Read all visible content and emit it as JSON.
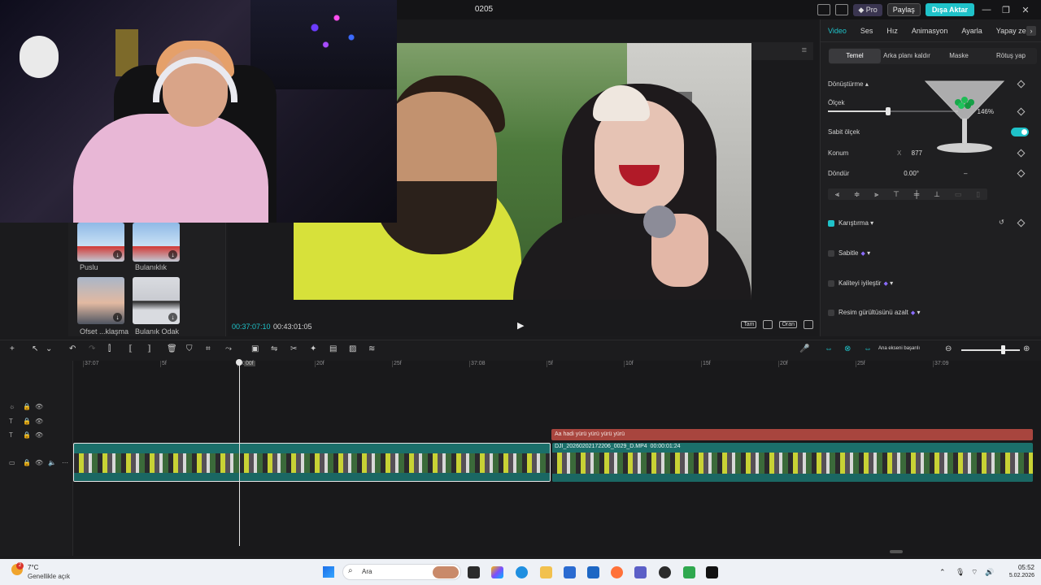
{
  "window": {
    "title": "0205"
  },
  "titlebar": {
    "pro_label": "Pro",
    "share_label": "Paylaş",
    "export_label": "Dışa Aktar",
    "minimize": "—",
    "restore": "❐",
    "close": "✕"
  },
  "media": {
    "items": [
      {
        "label": "Puslu",
        "icon": "download-icon"
      },
      {
        "label": "Bulanıklık",
        "icon": "download-icon"
      },
      {
        "label": "Ofset ...klaşma",
        "icon": "download-icon"
      },
      {
        "label": "Bulanık Odak",
        "icon": "download-icon"
      }
    ]
  },
  "player": {
    "current_time": "00:37:07:10",
    "total_time": "00:43:01:05",
    "menu_icon": "≡",
    "play_icon": "▶",
    "full_label": "Tam",
    "ratio_label": "Oran"
  },
  "inspector": {
    "tabs": [
      "Video",
      "Ses",
      "Hız",
      "Animasyon",
      "Ayarla",
      "Yapay zek"
    ],
    "active_tab": "Video",
    "sub_tabs": [
      "Temel",
      "Arka planı kaldır",
      "Maske",
      "Rötuş yap"
    ],
    "active_sub_tab": "Temel",
    "transform_label": "Dönüştürme",
    "scale_label": "Ölçek",
    "scale_value": "146%",
    "scale_level": 0.46,
    "uniform_scale_label": "Sabit ölçek",
    "uniform_scale_on": true,
    "position_label": "Konum",
    "position_x_label": "X",
    "position_x_value": "877",
    "rotate_label": "Döndür",
    "rotate_value": "0.00°",
    "rotate_dash": "–",
    "blend_label": "Karıştırma",
    "blend_on": true,
    "stabilize_label": "Sabitle",
    "stabilize_on": false,
    "enhance_label": "Kaliteyi iyileştir",
    "enhance_on": false,
    "denoise_label": "Resim gürültüsünü azalt",
    "denoise_on": false
  },
  "timeline": {
    "ruler": [
      "37:07",
      "5f",
      "10f",
      "20f",
      "25f",
      "37:08",
      "5f",
      "10f",
      "15f",
      "20f",
      "25f",
      "37:09"
    ],
    "playhead_label": "00f",
    "text_clip": {
      "prefix": "Aa",
      "label": "hadi yürü yürü yürü yürü"
    },
    "video_clip": {
      "name": "DJI_20260202172206_0029_D.MP4",
      "duration": "00:00:01:24"
    },
    "toolbar_hint": "Ana ekseni başarılı"
  },
  "taskbar": {
    "temperature": "7°C",
    "weather": "Genellikle açık",
    "weather_badge": "2",
    "search_placeholder": "Ara",
    "time": "05:52",
    "date": "5.02.2026"
  },
  "colors": {
    "accent": "#1fc2c9",
    "text_clip": "#a8453e",
    "video_clip": "#1b6f6a"
  }
}
